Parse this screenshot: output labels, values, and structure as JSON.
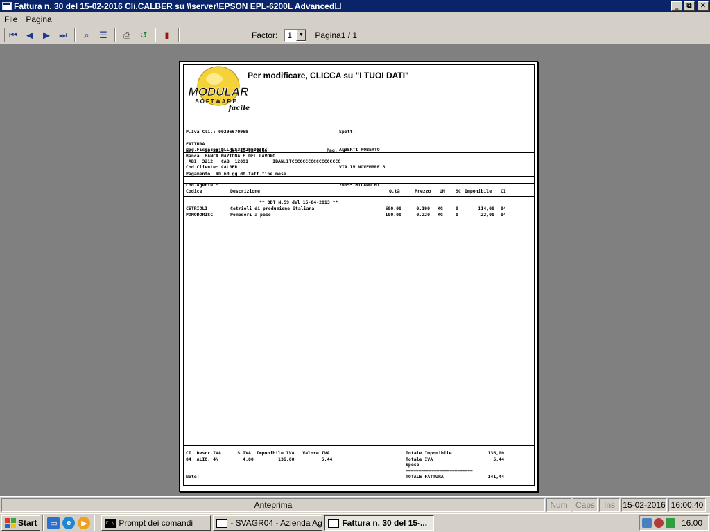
{
  "window": {
    "title": "Fattura n.  30 del 15-02-2016 Cli.CALBER su \\\\server\\EPSON EPL-6200L Advanced☐",
    "minimize_glyph": "_",
    "maximize_glyph": "⧉",
    "close_glyph": "✕"
  },
  "menu": {
    "file": "File",
    "pagina": "Pagina"
  },
  "toolbar": {
    "first_glyph": "⏮",
    "prev_glyph": "◀",
    "next_glyph": "▶",
    "last_glyph": "⏭",
    "zoom_glyph": "⌕",
    "book_glyph": "☰",
    "print_glyph": "⎙",
    "export_glyph": "↺",
    "exit_glyph": "▮",
    "factor_label": "Factor:",
    "factor_value": "1",
    "page_label": "Pagina1 / 1",
    "icons": [
      "first-page-icon",
      "previous-page-icon",
      "next-page-icon",
      "last-page-icon",
      "zoom-icon",
      "book-icon",
      "printer-icon",
      "export-icon",
      "exit-door-icon"
    ]
  },
  "document": {
    "logo_text": "MODULAR",
    "logo_sub": "SOFTWARE",
    "logo_script": "facile",
    "header_title": "Per modificare, CLICCA su  \"I TUOI DATI\"",
    "customer_left": [
      "P.Iva Cli.: 00296670969",
      "Cod.Fiscale: DLLPLA33P29E063R",
      "Cod.Cliente: CALBER",
      "Cod.Agente :"
    ],
    "customer_right": [
      "Spett.",
      "ALBERTI ROBERTO",
      "VIA IV NOVEMBRE 8",
      "20095 MILANO MI"
    ],
    "doc_type": "FATTURA",
    "doc_number_line": "N.:    30/2016  del 15-02-2016",
    "page_line": "Pag.  1",
    "bank_line": "Banca  BANCA NAZIONALE DEL LAVORO",
    "abi_line": " ABI  3212   CAB  12091         IBAN:ITCCCCCCCCCCCCCCCCCC",
    "payment_line": "Pagamento  RD 60 gg.dt.fatt.fine mese",
    "columns": [
      "Codice",
      "Descrizione",
      "Q.tà",
      "Prezzo",
      "UM",
      "SC",
      "Imponibile",
      "CI"
    ],
    "ddt_line": "** DDT N.59 del 15-04-2013 **",
    "rows": [
      {
        "codice": "CETRIOLI",
        "descrizione": "Cetrioli di produzione italiana",
        "qta": "600.00",
        "prezzo": "0.190",
        "um": "KG",
        "sc": "0",
        "imponibile": "114,00",
        "ci": "04"
      },
      {
        "codice": "POMODORISC",
        "descrizione": "Pomodori a peso",
        "qta": "100.00",
        "prezzo": "0.220",
        "um": "KG",
        "sc": "0",
        "imponibile": "22,00",
        "ci": "04"
      }
    ],
    "vat_header": "CI  Descr.IVA      % IVA  Imponibile IVA   Valore IVA",
    "vat_row": "04  ALIQ. 4%         4,00         136,00          5,44",
    "note_label": "Note:",
    "totals": [
      {
        "label": "Totale Imponibile",
        "value": "136,00"
      },
      {
        "label": "Totale IVA",
        "value": "5,44"
      },
      {
        "label": "Spese",
        "value": ""
      }
    ],
    "totals_rule": "==========================",
    "total_label": "TOTALE FATTURA",
    "total_value": "141,44"
  },
  "status": {
    "mode": "Anteprima",
    "num": "Num",
    "caps": "Caps",
    "ins": "Ins",
    "date": "15-02-2016",
    "time": "16:00:40"
  },
  "taskbar": {
    "start": "Start",
    "tasks": [
      {
        "label": "Prompt dei comandi",
        "icon": "cmd-icon",
        "active": false
      },
      {
        "label": "- SVAGR04 - Azienda Agr...",
        "icon": "window-icon",
        "active": false
      },
      {
        "label": "Fattura n.  30 del 15-...",
        "icon": "window-icon",
        "active": true
      }
    ],
    "clock": "16.00",
    "cmd_glyph": "C:\\",
    "quick_launch": [
      "show-desktop-icon",
      "internet-explorer-icon",
      "media-player-icon"
    ],
    "tray_icons": [
      "network-icon",
      "security-icon",
      "update-icon"
    ]
  },
  "colors": {
    "title_bar": "#0a246a",
    "chrome": "#d4d0c8",
    "workspace": "#808080"
  }
}
